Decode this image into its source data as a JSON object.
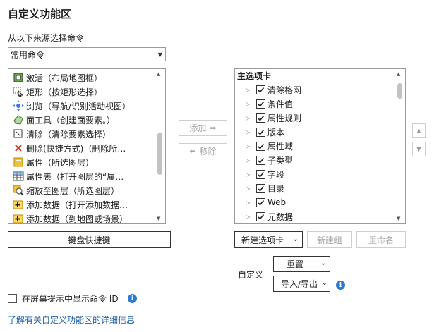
{
  "title": "自定义功能区",
  "source": {
    "label": "从以下来源选择命令",
    "selected": "常用命令"
  },
  "commands": [
    {
      "label": "激活（布局地图框）",
      "icon": "activate-icon"
    },
    {
      "label": "矩形（按矩形选择）",
      "icon": "select-rectangle-icon"
    },
    {
      "label": "浏览（导航/识别活动视图）",
      "icon": "explore-icon"
    },
    {
      "label": "面工具（创建面要素。）",
      "icon": "polygon-tool-icon"
    },
    {
      "label": "清除（清除要素选择）",
      "icon": "clear-selection-icon"
    },
    {
      "label": "删除(快捷方式)（删除所…",
      "icon": "delete-icon"
    },
    {
      "label": "属性（所选图层）",
      "icon": "properties-icon"
    },
    {
      "label": "属性表（打开图层的“属…",
      "icon": "attribute-table-icon"
    },
    {
      "label": "缩放至图层（所选图层）",
      "icon": "zoom-to-layer-icon"
    },
    {
      "label": "添加数据（打开添加数据…",
      "icon": "add-data-icon"
    },
    {
      "label": "添加数据（到地图或场景）",
      "icon": "add-data-icon"
    }
  ],
  "middle_buttons": {
    "add": "添加",
    "remove": "移除"
  },
  "tabs_tree": {
    "header": "主选项卡",
    "items": [
      {
        "label": "清除格网",
        "checked": true
      },
      {
        "label": "条件值",
        "checked": true
      },
      {
        "label": "属性规则",
        "checked": true
      },
      {
        "label": "版本",
        "checked": true
      },
      {
        "label": "属性域",
        "checked": true
      },
      {
        "label": "子类型",
        "checked": true
      },
      {
        "label": "字段",
        "checked": true
      },
      {
        "label": "目录",
        "checked": true
      },
      {
        "label": "Web",
        "checked": true
      },
      {
        "label": "元数据",
        "checked": true
      }
    ]
  },
  "keyboard_shortcuts": "键盘快捷键",
  "new_tab": "新建选项卡",
  "new_group": "新建组",
  "rename": "重命名",
  "customize": {
    "label": "自定义",
    "reset": "重置",
    "import_export": "导入/导出"
  },
  "show_ids": {
    "label": "在屏幕提示中显示命令 ID",
    "checked": false
  },
  "learn_more": "了解有关自定义功能区的详细信息",
  "colors": {
    "link": "#1f5fa8",
    "info": "#2b7bd0"
  }
}
